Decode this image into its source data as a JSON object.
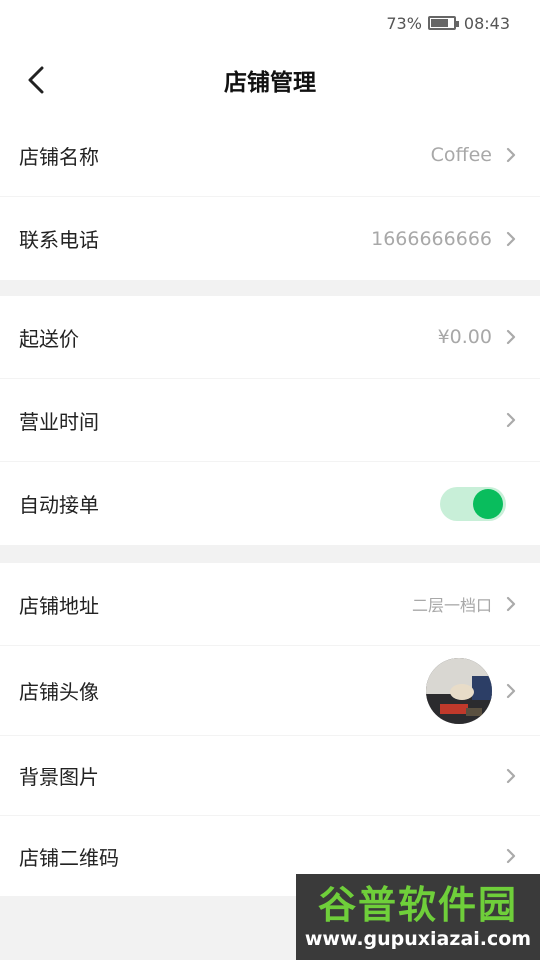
{
  "status_bar": {
    "battery": "73%",
    "time": "08:43"
  },
  "header": {
    "title": "店铺管理",
    "back_icon": "chevron-left-icon"
  },
  "group1": [
    {
      "label": "店铺名称",
      "value": "Coffee"
    },
    {
      "label": "联系电话",
      "value": "1666666666"
    }
  ],
  "group2": [
    {
      "label": "起送价",
      "value": "¥0.00"
    },
    {
      "label": "营业时间",
      "value": ""
    },
    {
      "label": "自动接单",
      "toggle_on": true,
      "accent": "#09bd5d"
    }
  ],
  "group3": [
    {
      "label": "店铺地址",
      "value": "二层一档口"
    },
    {
      "label": "店铺头像",
      "value": ""
    },
    {
      "label": "背景图片",
      "value": ""
    },
    {
      "label": "店铺二维码",
      "value": ""
    }
  ],
  "watermark": {
    "title": "谷普软件园",
    "url": "www.gupuxiazai.com"
  }
}
